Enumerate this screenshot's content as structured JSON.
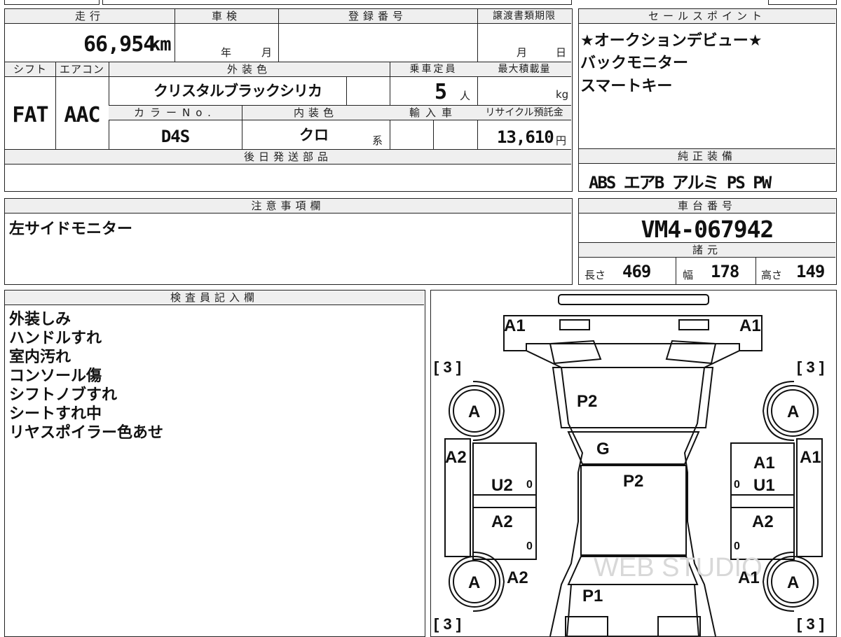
{
  "headers": {
    "mileage": "走行",
    "shaken": "車検",
    "registration": "登録番号",
    "transfer_deadline": "譲渡書類期限",
    "sales_points": "セールスポイント",
    "shift": "シフト",
    "aircon": "エアコン",
    "exterior_color": "外装色",
    "capacity": "乗車定員",
    "max_load": "最大積載量",
    "color_no": "カラーNo.",
    "interior_color": "内装色",
    "import": "輸入車",
    "recycle": "リサイクル預託金",
    "later_parts": "後日発送部品",
    "genuine_equipment": "純正装備",
    "notes": "注意事項欄",
    "chassis_no": "車台番号",
    "specs": "諸元",
    "inspector": "検査員記入欄"
  },
  "vehicle": {
    "mileage_value": "66,954",
    "mileage_unit": "km",
    "shaken_year": "年",
    "shaken_month": "月",
    "transfer_month": "月",
    "transfer_day": "日",
    "shift": "FAT",
    "aircon": "AAC",
    "exterior_color": "クリスタルブラックシリカ",
    "capacity_value": "5",
    "capacity_unit": "人",
    "max_load_unit": "kg",
    "color_no": "D4S",
    "interior_color": "クロ",
    "interior_suffix": "系",
    "recycle_value": "13,610",
    "recycle_unit": "円",
    "chassis_no": "VM4-067942",
    "length_label": "長さ",
    "length_value": "469",
    "width_label": "幅",
    "width_value": "178",
    "height_label": "高さ",
    "height_value": "149"
  },
  "sales_points": [
    "★オークションデビュー★",
    "バックモニター",
    "スマートキー"
  ],
  "genuine_equipment": "ABS エアB アルミ PS PW",
  "notes": "左サイドモニター",
  "inspector_notes": [
    "外装しみ",
    "ハンドルすれ",
    "室内汚れ",
    "コンソール傷",
    "シフトノブすれ",
    "シートすれ中",
    "リヤスポイラー色あせ"
  ],
  "diagram": {
    "watermark": "WEB STUDIO",
    "marks": {
      "front_left": "A1",
      "front_right": "A1",
      "hood": "P2",
      "windshield": "G",
      "roof": "P2",
      "trunk": "P1",
      "left_front_door": "U2",
      "left_rear_door": "A2",
      "right_front_door": "U1",
      "right_rear_door": "A2",
      "left_fender_front": "A2",
      "right_fender_front": "A1",
      "left_rear_quarter": "A2",
      "right_rear_quarter": "A1",
      "wheel": "A",
      "bracket_3": "3",
      "zero": "0"
    }
  }
}
